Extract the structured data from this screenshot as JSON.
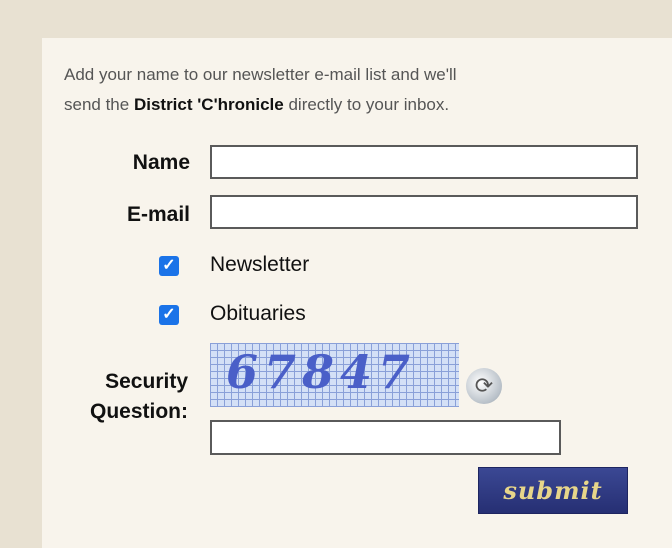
{
  "intro": {
    "line1": "Add your name to our newsletter e-mail list and we'll",
    "line2_prefix": "send the ",
    "publication": "District 'C'hronicle",
    "line2_suffix": " directly to your inbox."
  },
  "form": {
    "name_label": "Name",
    "name_value": "",
    "email_label": "E-mail",
    "email_value": "",
    "options": [
      {
        "label": "Newsletter",
        "checked": true
      },
      {
        "label": "Obituaries",
        "checked": true
      }
    ],
    "security_label_line1": "Security",
    "security_label_line2": "Question:",
    "captcha_text": "67847",
    "security_answer": "",
    "submit_label": "submit"
  },
  "icons": {
    "checkbox": "check-icon",
    "refresh": "refresh-icon"
  },
  "colors": {
    "page_bg": "#e8e1d2",
    "panel_bg": "#f8f4ec",
    "checkbox": "#1b73e8",
    "submit_bg": "#2d3880",
    "submit_text": "#e7d68a"
  }
}
